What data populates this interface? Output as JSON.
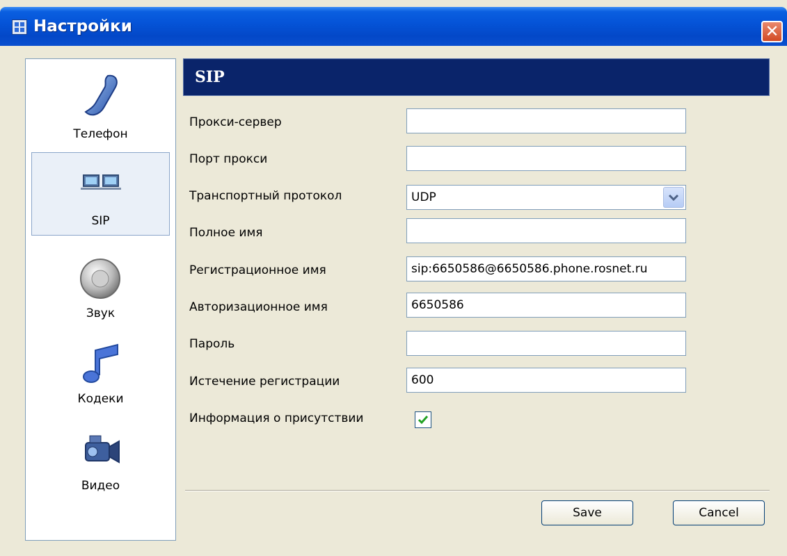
{
  "window": {
    "title": "Настройки",
    "close_label": "✕"
  },
  "sidebar": {
    "items": [
      {
        "label": "Телефон",
        "icon": "phone-handset-icon"
      },
      {
        "label": "SIP",
        "icon": "network-computers-icon",
        "active": true
      },
      {
        "label": "Звук",
        "icon": "speaker-icon"
      },
      {
        "label": "Кодеки",
        "icon": "music-note-icon"
      },
      {
        "label": "Видео",
        "icon": "video-camera-icon"
      }
    ]
  },
  "panel": {
    "title": "SIP",
    "fields": {
      "proxy_server": {
        "label": "Прокси-сервер",
        "value": ""
      },
      "proxy_port": {
        "label": "Порт прокси",
        "value": ""
      },
      "transport": {
        "label": "Транспортный протокол",
        "value": "UDP"
      },
      "full_name": {
        "label": "Полное имя",
        "value": ""
      },
      "registration_name": {
        "label": "Регистрационное имя",
        "value": "sip:6650586@6650586.phone.rosnet.ru"
      },
      "auth_name": {
        "label": "Авторизационное имя",
        "value": "6650586"
      },
      "password": {
        "label": "Пароль",
        "value": ""
      },
      "registration_expiry": {
        "label": "Истечение регистрации",
        "value": "600"
      },
      "presence": {
        "label": "Информация о присутствии",
        "checked": true
      }
    }
  },
  "buttons": {
    "save": "Save",
    "cancel": "Cancel"
  },
  "colors": {
    "header_bg": "#0a246a",
    "title_bar": "#0554d8",
    "window_bg": "#ece9d8"
  }
}
